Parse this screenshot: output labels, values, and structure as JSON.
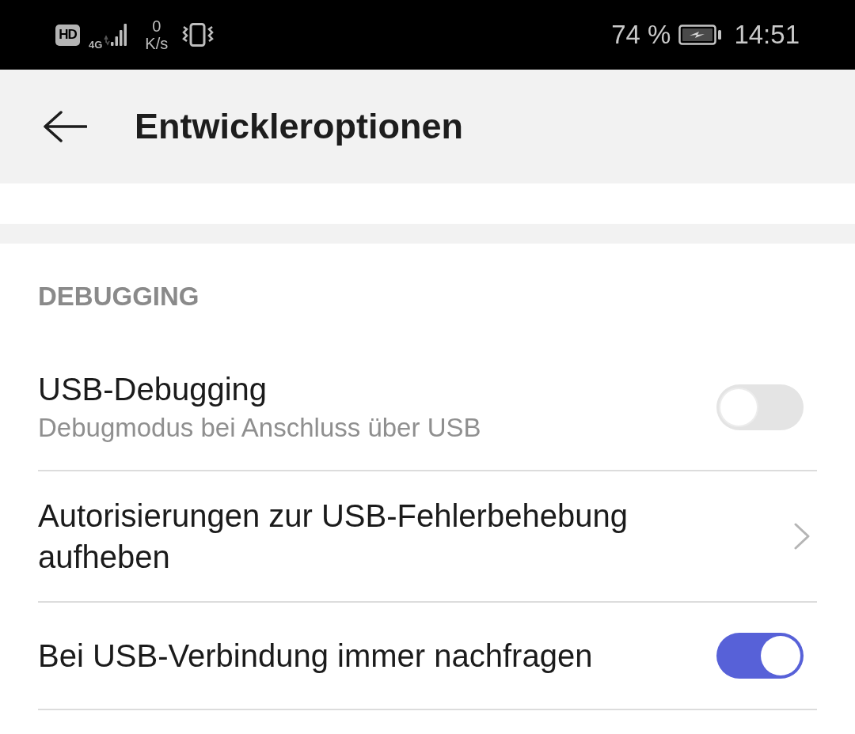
{
  "status_bar": {
    "hd_badge": "HD",
    "network_type": "4G",
    "data_rate_value": "0",
    "data_rate_unit": "K/s",
    "battery_percent": "74 %",
    "battery_charging": true,
    "time": "14:51"
  },
  "header": {
    "title": "Entwickleroptionen"
  },
  "section": {
    "title": "DEBUGGING",
    "items": [
      {
        "kind": "toggle",
        "title": "USB-Debugging",
        "subtitle": "Debugmodus bei Anschluss über USB",
        "on": false
      },
      {
        "kind": "link",
        "title": "Autorisierungen zur USB-Fehlerbehebung aufheben"
      },
      {
        "kind": "toggle",
        "title": "Bei USB-Verbindung immer nachfragen",
        "on": true
      }
    ]
  }
}
